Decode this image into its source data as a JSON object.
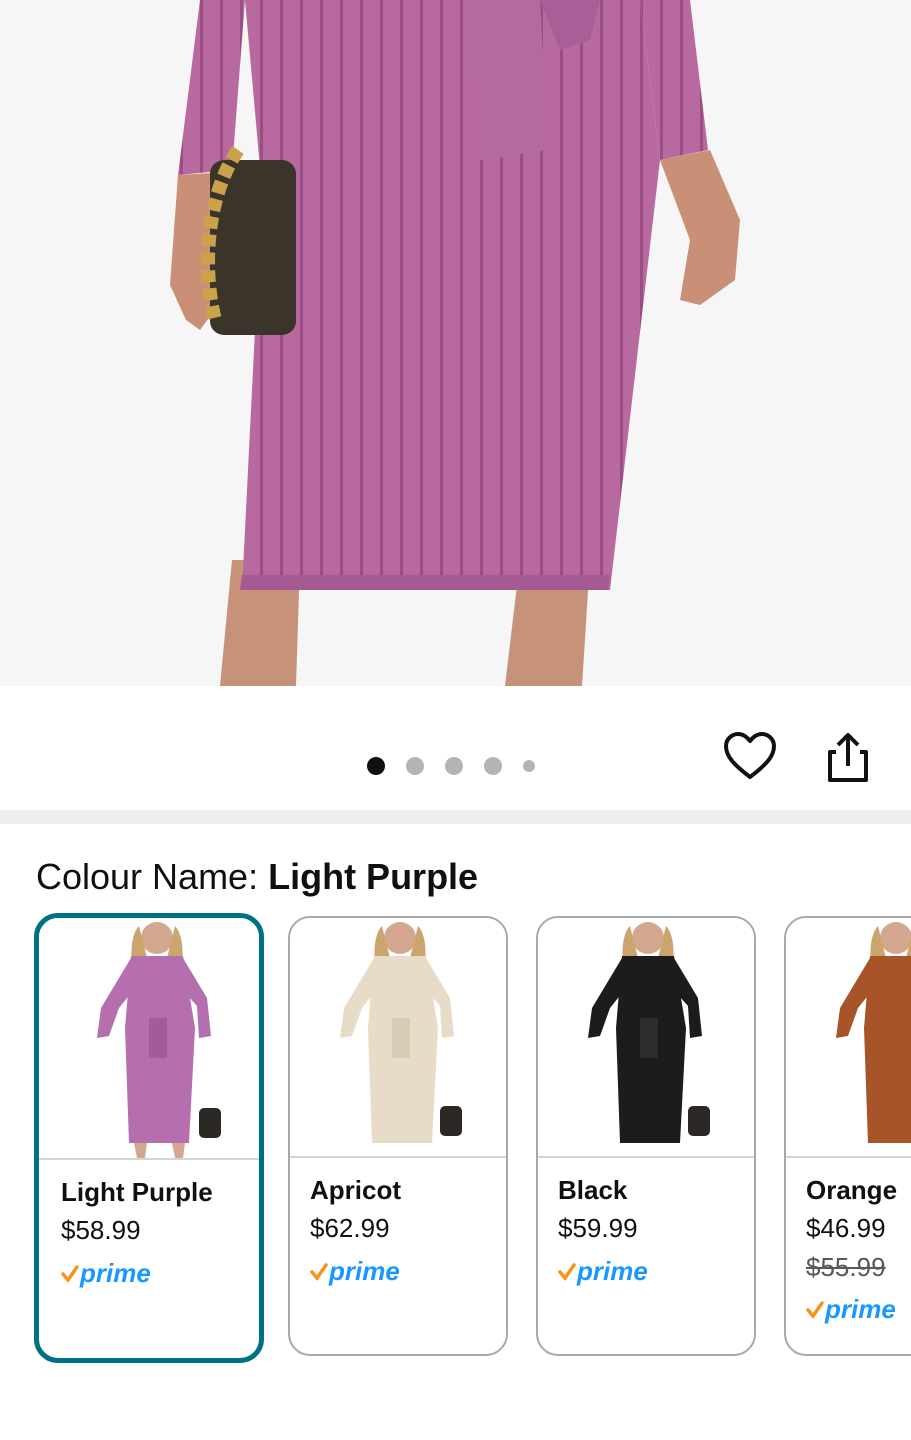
{
  "product": {
    "image_alt": "Light purple ribbed knit midi dress",
    "gallery": {
      "total_images": 5,
      "active_index": 0
    }
  },
  "actions": {
    "favorite_icon": "heart-icon",
    "share_icon": "share-icon"
  },
  "colour": {
    "label": "Colour Name: ",
    "selected": "Light Purple"
  },
  "swatches": [
    {
      "name": "Light Purple",
      "price": "$58.99",
      "old_price": "",
      "prime": "prime",
      "color": "#b56fae",
      "selected": true
    },
    {
      "name": "Apricot",
      "price": "$62.99",
      "old_price": "",
      "prime": "prime",
      "color": "#e8dcc8",
      "selected": false
    },
    {
      "name": "Black",
      "price": "$59.99",
      "old_price": "",
      "prime": "prime",
      "color": "#1c1c1c",
      "selected": false
    },
    {
      "name": "Orange",
      "price": "$46.99",
      "old_price": "$55.99",
      "prime": "prime",
      "color": "#a65428",
      "selected": false
    }
  ],
  "colors": {
    "accent": "#007185",
    "prime_blue": "#1a98ff",
    "prime_check": "#f7931e",
    "dress": "#b56fae"
  }
}
